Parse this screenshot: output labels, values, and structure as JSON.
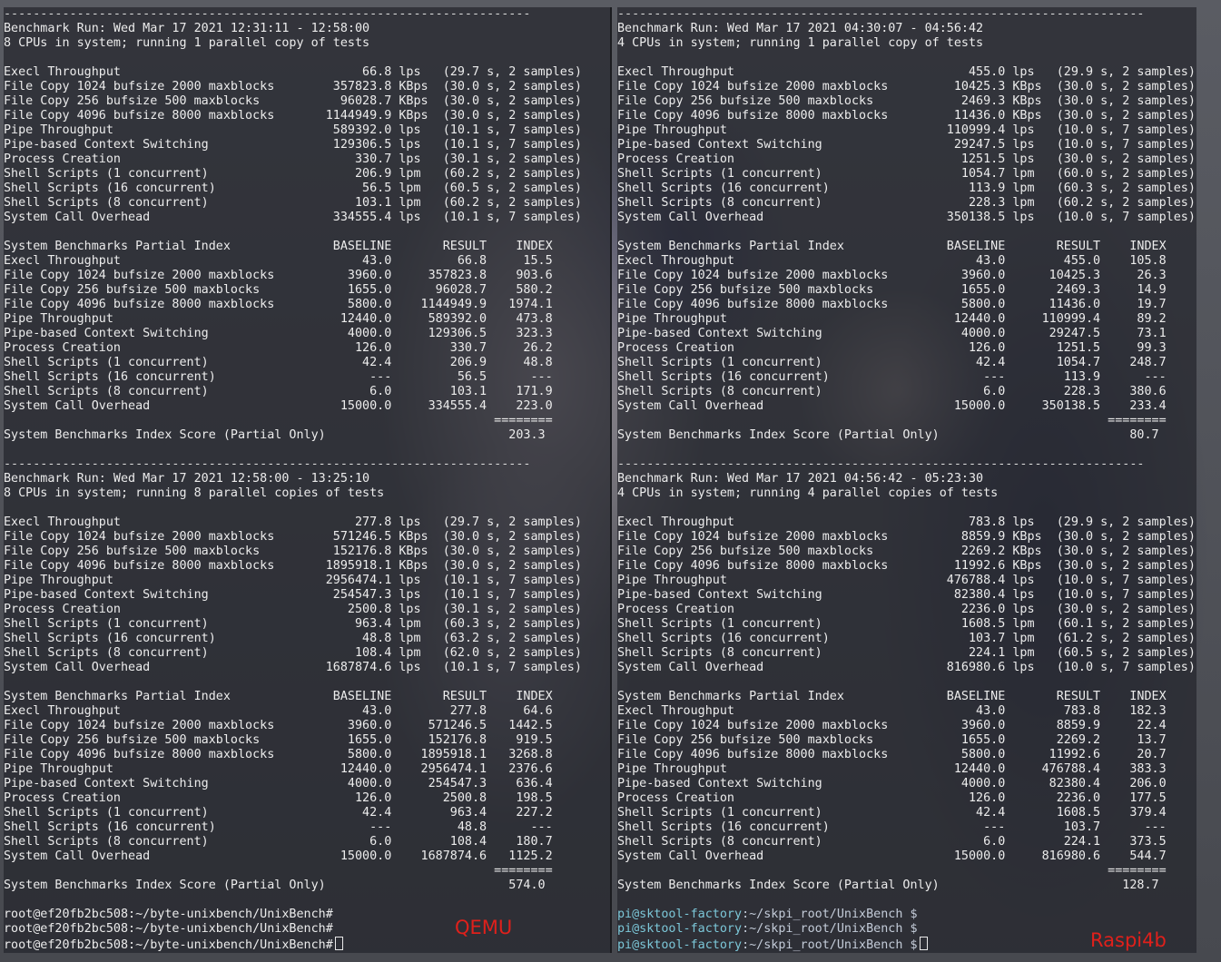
{
  "left": {
    "label": "QEMU",
    "sep": "------------------------------------------------------------------------",
    "runs": [
      {
        "header": "Benchmark Run: Wed Mar 17 2021 12:31:11 - 12:58:00",
        "cpus": "8 CPUs in system; running 1 parallel copy of tests",
        "results": [
          "Execl Throughput                                 66.8 lps   (29.7 s, 2 samples)",
          "File Copy 1024 bufsize 2000 maxblocks        357823.8 KBps  (30.0 s, 2 samples)",
          "File Copy 256 bufsize 500 maxblocks           96028.7 KBps  (30.0 s, 2 samples)",
          "File Copy 4096 bufsize 8000 maxblocks       1144949.9 KBps  (30.0 s, 2 samples)",
          "Pipe Throughput                              589392.0 lps   (10.1 s, 7 samples)",
          "Pipe-based Context Switching                 129306.5 lps   (10.1 s, 7 samples)",
          "Process Creation                                330.7 lps   (30.1 s, 2 samples)",
          "Shell Scripts (1 concurrent)                    206.9 lpm   (60.2 s, 2 samples)",
          "Shell Scripts (16 concurrent)                    56.5 lpm   (60.5 s, 2 samples)",
          "Shell Scripts (8 concurrent)                    103.1 lpm   (60.2 s, 2 samples)",
          "System Call Overhead                         334555.4 lps   (10.1 s, 7 samples)"
        ],
        "index_header": "System Benchmarks Partial Index              BASELINE       RESULT    INDEX",
        "index_rows": [
          "Execl Throughput                                 43.0         66.8     15.5",
          "File Copy 1024 bufsize 2000 maxblocks          3960.0     357823.8    903.6",
          "File Copy 256 bufsize 500 maxblocks            1655.0      96028.7    580.2",
          "File Copy 4096 bufsize 8000 maxblocks          5800.0    1144949.9   1974.1",
          "Pipe Throughput                               12440.0     589392.0    473.8",
          "Pipe-based Context Switching                   4000.0     129306.5    323.3",
          "Process Creation                                126.0        330.7     26.2",
          "Shell Scripts (1 concurrent)                     42.4        206.9     48.8",
          "Shell Scripts (16 concurrent)                     ---         56.5      ---",
          "Shell Scripts (8 concurrent)                      6.0        103.1    171.9",
          "System Call Overhead                          15000.0     334555.4    223.0"
        ],
        "rule": "                                                                   ========",
        "score": "System Benchmarks Index Score (Partial Only)                         203.3"
      },
      {
        "header": "Benchmark Run: Wed Mar 17 2021 12:58:00 - 13:25:10",
        "cpus": "8 CPUs in system; running 8 parallel copies of tests",
        "results": [
          "Execl Throughput                                277.8 lps   (29.7 s, 2 samples)",
          "File Copy 1024 bufsize 2000 maxblocks        571246.5 KBps  (30.0 s, 2 samples)",
          "File Copy 256 bufsize 500 maxblocks          152176.8 KBps  (30.0 s, 2 samples)",
          "File Copy 4096 bufsize 8000 maxblocks       1895918.1 KBps  (30.0 s, 2 samples)",
          "Pipe Throughput                             2956474.1 lps   (10.1 s, 7 samples)",
          "Pipe-based Context Switching                 254547.3 lps   (10.1 s, 7 samples)",
          "Process Creation                               2500.8 lps   (30.1 s, 2 samples)",
          "Shell Scripts (1 concurrent)                    963.4 lpm   (60.3 s, 2 samples)",
          "Shell Scripts (16 concurrent)                    48.8 lpm   (63.2 s, 2 samples)",
          "Shell Scripts (8 concurrent)                    108.4 lpm   (62.0 s, 2 samples)",
          "System Call Overhead                        1687874.6 lps   (10.1 s, 7 samples)"
        ],
        "index_header": "System Benchmarks Partial Index              BASELINE       RESULT    INDEX",
        "index_rows": [
          "Execl Throughput                                 43.0        277.8     64.6",
          "File Copy 1024 bufsize 2000 maxblocks          3960.0     571246.5   1442.5",
          "File Copy 256 bufsize 500 maxblocks            1655.0     152176.8    919.5",
          "File Copy 4096 bufsize 8000 maxblocks          5800.0    1895918.1   3268.8",
          "Pipe Throughput                               12440.0    2956474.1   2376.6",
          "Pipe-based Context Switching                   4000.0     254547.3    636.4",
          "Process Creation                                126.0       2500.8    198.5",
          "Shell Scripts (1 concurrent)                     42.4        963.4    227.2",
          "Shell Scripts (16 concurrent)                     ---         48.8      ---",
          "Shell Scripts (8 concurrent)                      6.0        108.4    180.7",
          "System Call Overhead                          15000.0    1687874.6   1125.2"
        ],
        "rule": "                                                                   ========",
        "score": "System Benchmarks Index Score (Partial Only)                         574.0"
      }
    ],
    "prompts": [
      {
        "text": "root@ef20fb2bc508:~/byte-unixbench/UnixBench#",
        "cursor": false
      },
      {
        "text": "root@ef20fb2bc508:~/byte-unixbench/UnixBench#",
        "cursor": false
      },
      {
        "text": "root@ef20fb2bc508:~/byte-unixbench/UnixBench#",
        "cursor": true
      }
    ]
  },
  "right": {
    "label": "Raspi4b",
    "sep": "------------------------------------------------------------------------",
    "runs": [
      {
        "header": "Benchmark Run: Wed Mar 17 2021 04:30:07 - 04:56:42",
        "cpus": "4 CPUs in system; running 1 parallel copy of tests",
        "results": [
          "Execl Throughput                                455.0 lps   (29.9 s, 2 samples)",
          "File Copy 1024 bufsize 2000 maxblocks         10425.3 KBps  (30.0 s, 2 samples)",
          "File Copy 256 bufsize 500 maxblocks            2469.3 KBps  (30.0 s, 2 samples)",
          "File Copy 4096 bufsize 8000 maxblocks         11436.0 KBps  (30.0 s, 2 samples)",
          "Pipe Throughput                              110999.4 lps   (10.0 s, 7 samples)",
          "Pipe-based Context Switching                  29247.5 lps   (10.0 s, 7 samples)",
          "Process Creation                               1251.5 lps   (30.0 s, 2 samples)",
          "Shell Scripts (1 concurrent)                   1054.7 lpm   (60.0 s, 2 samples)",
          "Shell Scripts (16 concurrent)                   113.9 lpm   (60.3 s, 2 samples)",
          "Shell Scripts (8 concurrent)                    228.3 lpm   (60.2 s, 2 samples)",
          "System Call Overhead                         350138.5 lps   (10.0 s, 7 samples)"
        ],
        "index_header": "System Benchmarks Partial Index              BASELINE       RESULT    INDEX",
        "index_rows": [
          "Execl Throughput                                 43.0        455.0    105.8",
          "File Copy 1024 bufsize 2000 maxblocks          3960.0      10425.3     26.3",
          "File Copy 256 bufsize 500 maxblocks            1655.0       2469.3     14.9",
          "File Copy 4096 bufsize 8000 maxblocks          5800.0      11436.0     19.7",
          "Pipe Throughput                               12440.0     110999.4     89.2",
          "Pipe-based Context Switching                   4000.0      29247.5     73.1",
          "Process Creation                                126.0       1251.5     99.3",
          "Shell Scripts (1 concurrent)                     42.4       1054.7    248.7",
          "Shell Scripts (16 concurrent)                     ---        113.9      ---",
          "Shell Scripts (8 concurrent)                      6.0        228.3    380.6",
          "System Call Overhead                          15000.0     350138.5    233.4"
        ],
        "rule": "                                                                   ========",
        "score": "System Benchmarks Index Score (Partial Only)                          80.7"
      },
      {
        "header": "Benchmark Run: Wed Mar 17 2021 04:56:42 - 05:23:30",
        "cpus": "4 CPUs in system; running 4 parallel copies of tests",
        "results": [
          "Execl Throughput                                783.8 lps   (29.9 s, 2 samples)",
          "File Copy 1024 bufsize 2000 maxblocks          8859.9 KBps  (30.0 s, 2 samples)",
          "File Copy 256 bufsize 500 maxblocks            2269.2 KBps  (30.0 s, 2 samples)",
          "File Copy 4096 bufsize 8000 maxblocks         11992.6 KBps  (30.0 s, 2 samples)",
          "Pipe Throughput                              476788.4 lps   (10.0 s, 7 samples)",
          "Pipe-based Context Switching                  82380.4 lps   (10.0 s, 7 samples)",
          "Process Creation                               2236.0 lps   (30.0 s, 2 samples)",
          "Shell Scripts (1 concurrent)                   1608.5 lpm   (60.1 s, 2 samples)",
          "Shell Scripts (16 concurrent)                   103.7 lpm   (61.2 s, 2 samples)",
          "Shell Scripts (8 concurrent)                    224.1 lpm   (60.5 s, 2 samples)",
          "System Call Overhead                         816980.6 lps   (10.0 s, 7 samples)"
        ],
        "index_header": "System Benchmarks Partial Index              BASELINE       RESULT    INDEX",
        "index_rows": [
          "Execl Throughput                                 43.0        783.8    182.3",
          "File Copy 1024 bufsize 2000 maxblocks          3960.0       8859.9     22.4",
          "File Copy 256 bufsize 500 maxblocks            1655.0       2269.2     13.7",
          "File Copy 4096 bufsize 8000 maxblocks          5800.0      11992.6     20.7",
          "Pipe Throughput                               12440.0     476788.4    383.3",
          "Pipe-based Context Switching                   4000.0      82380.4    206.0",
          "Process Creation                                126.0       2236.0    177.5",
          "Shell Scripts (1 concurrent)                     42.4       1608.5    379.4",
          "Shell Scripts (16 concurrent)                     ---        103.7      ---",
          "Shell Scripts (8 concurrent)                      6.0        224.1    373.5",
          "System Call Overhead                          15000.0     816980.6    544.7"
        ],
        "rule": "                                                                   ========",
        "score": "System Benchmarks Index Score (Partial Only)                         128.7"
      }
    ],
    "prompts": [
      {
        "user": "pi@sktool-factory",
        "path": ":~/skpi_root/UnixBench $",
        "cursor": false
      },
      {
        "user": "pi@sktool-factory",
        "path": ":~/skpi_root/UnixBench $",
        "cursor": false
      },
      {
        "user": "pi@sktool-factory",
        "path": ":~/skpi_root/UnixBench $",
        "cursor": true
      }
    ]
  }
}
